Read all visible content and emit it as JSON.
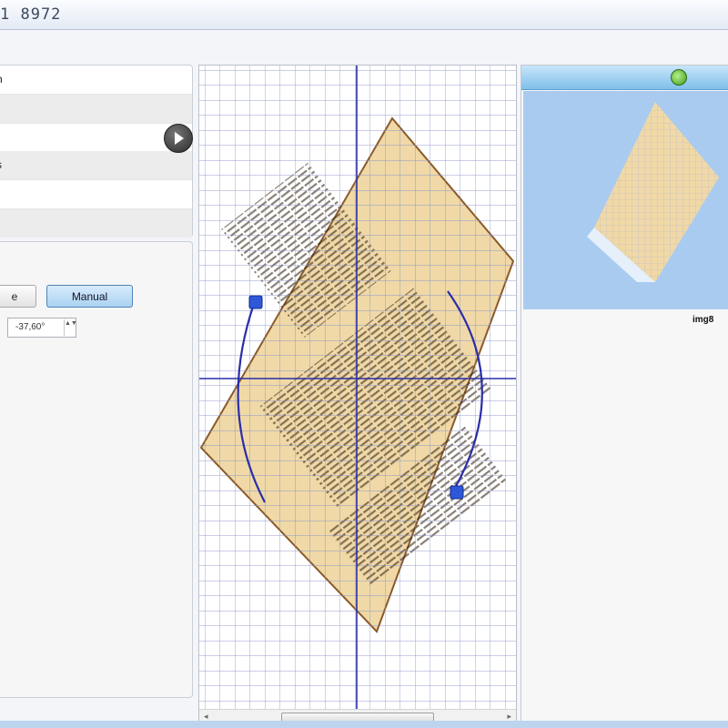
{
  "window": {
    "title": "1 8972"
  },
  "list": {
    "items": [
      {
        "label": "h"
      },
      {
        "label": ""
      },
      {
        "label": ""
      },
      {
        "label": "s"
      },
      {
        "label": ""
      }
    ]
  },
  "rotation": {
    "auto_label": "e",
    "manual_label": "Manual",
    "angle_value": "-37,60°",
    "spinner_arrows": "▲▼"
  },
  "canvas": {
    "scroll_left_arrow": "◂",
    "scroll_right_arrow": "▸"
  },
  "thumbnail": {
    "caption": "img8"
  },
  "colors": {
    "accent": "#4d84b8",
    "grid_line": "#8c93c9",
    "axis_line": "#2a2ea8",
    "selection": "#a9cbf0",
    "paper": "#f0d9a7"
  }
}
